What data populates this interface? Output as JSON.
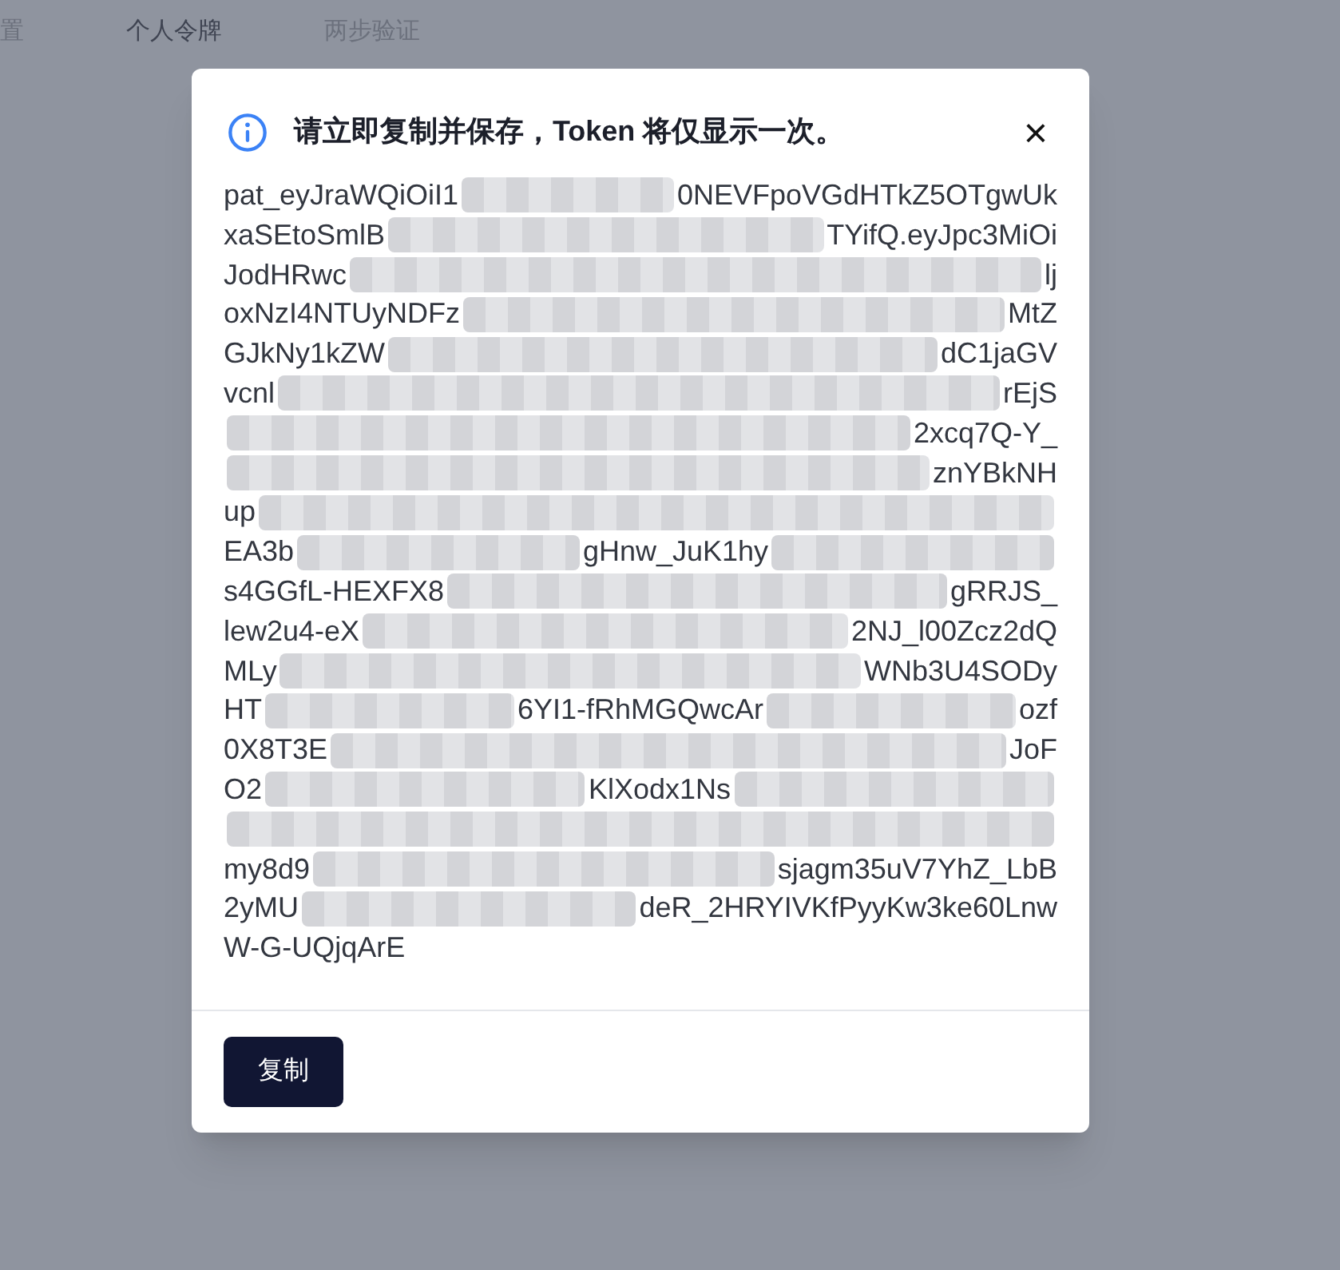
{
  "tabs": [
    {
      "label": "置",
      "selected": false
    },
    {
      "label": "个人令牌",
      "selected": true
    },
    {
      "label": "两步验证",
      "selected": false
    }
  ],
  "dialog": {
    "title": "请立即复制并保存，Token 将仅显示一次。",
    "close": "×",
    "token_lines": [
      [
        {
          "kind": "text",
          "text": "pat_eyJraWQiOiI1"
        },
        {
          "kind": "redacted"
        },
        {
          "kind": "text",
          "text": "0NEVFpoVGdHTkZ5OTgwUk"
        }
      ],
      [
        {
          "kind": "text",
          "text": "xaSEtoSmlB"
        },
        {
          "kind": "redacted"
        },
        {
          "kind": "text",
          "text": "TYifQ.eyJpc3MiOi"
        }
      ],
      [
        {
          "kind": "text",
          "text": "JodHRwc"
        },
        {
          "kind": "redacted"
        },
        {
          "kind": "text",
          "text": "lj"
        }
      ],
      [
        {
          "kind": "text",
          "text": "oxNzI4NTUyNDFz"
        },
        {
          "kind": "redacted"
        },
        {
          "kind": "text",
          "text": "MtZ"
        }
      ],
      [
        {
          "kind": "text",
          "text": "GJkNy1kZW"
        },
        {
          "kind": "redacted"
        },
        {
          "kind": "text",
          "text": "dC1jaGV"
        }
      ],
      [
        {
          "kind": "text",
          "text": "vcnl"
        },
        {
          "kind": "redacted"
        },
        {
          "kind": "text",
          "text": "rEjS"
        }
      ],
      [
        {
          "kind": "redacted"
        },
        {
          "kind": "text",
          "text": "2xcq7Q-Y_"
        }
      ],
      [
        {
          "kind": "redacted"
        },
        {
          "kind": "text",
          "text": "znYBkNH"
        }
      ],
      [
        {
          "kind": "text",
          "text": "up"
        },
        {
          "kind": "redacted"
        }
      ],
      [
        {
          "kind": "text",
          "text": "EA3b"
        },
        {
          "kind": "redacted"
        },
        {
          "kind": "text",
          "text": "gHnw_JuK1hy"
        },
        {
          "kind": "redacted"
        }
      ],
      [
        {
          "kind": "text",
          "text": "s4GGfL-HEXFX8"
        },
        {
          "kind": "redacted"
        },
        {
          "kind": "text",
          "text": "gRRJS_"
        }
      ],
      [
        {
          "kind": "text",
          "text": "lew2u4-eX"
        },
        {
          "kind": "redacted"
        },
        {
          "kind": "text",
          "text": "2NJ_l00Zcz2dQ"
        }
      ],
      [
        {
          "kind": "text",
          "text": "MLy"
        },
        {
          "kind": "redacted"
        },
        {
          "kind": "text",
          "text": "WNb3U4SODy"
        }
      ],
      [
        {
          "kind": "text",
          "text": "HT"
        },
        {
          "kind": "redacted"
        },
        {
          "kind": "text",
          "text": "6YI1-fRhMGQwcAr"
        },
        {
          "kind": "redacted"
        },
        {
          "kind": "text",
          "text": "ozf"
        }
      ],
      [
        {
          "kind": "text",
          "text": "0X8T3E"
        },
        {
          "kind": "redacted"
        },
        {
          "kind": "text",
          "text": "JoF"
        }
      ],
      [
        {
          "kind": "text",
          "text": "O2"
        },
        {
          "kind": "redacted"
        },
        {
          "kind": "text",
          "text": "KlXodx1Ns"
        },
        {
          "kind": "redacted"
        }
      ],
      [
        {
          "kind": "redacted"
        }
      ],
      [
        {
          "kind": "text",
          "text": "my8d9"
        },
        {
          "kind": "redacted"
        },
        {
          "kind": "text",
          "text": "sjagm35uV7YhZ_LbB"
        }
      ],
      [
        {
          "kind": "text",
          "text": "2yMU"
        },
        {
          "kind": "redacted"
        },
        {
          "kind": "text",
          "text": "deR_2HRYIVKfPyyKw3ke60Lnw"
        }
      ],
      [
        {
          "kind": "text",
          "text": "W-G-UQjqArE"
        }
      ]
    ],
    "button": "复制"
  }
}
